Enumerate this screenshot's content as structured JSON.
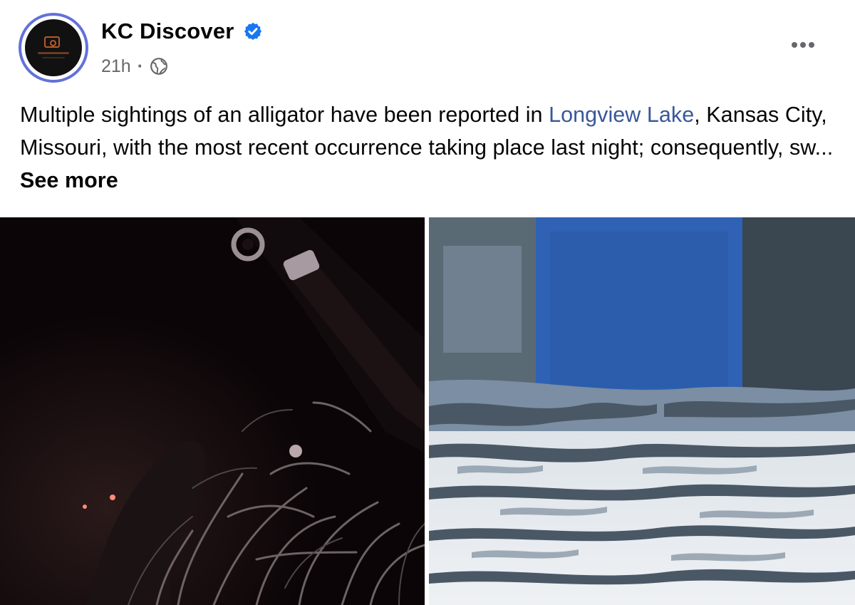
{
  "post": {
    "page_name": "KC Discover",
    "timestamp": "21h",
    "separator": "·",
    "text_before_link": "Multiple sightings of an alligator have been reported in ",
    "link_text": "Longview Lake",
    "text_after_link": ", Kansas City, Missouri, with the most recent occurrence taking place last night; consequently, sw...",
    "see_more": "See more"
  },
  "icons": {
    "verified": "verified-badge-icon",
    "audience": "globe-icon",
    "menu": "more-options-icon"
  },
  "colors": {
    "verified_badge": "#1877f2",
    "link": "#385898",
    "avatar_ring": "#6271d9"
  }
}
